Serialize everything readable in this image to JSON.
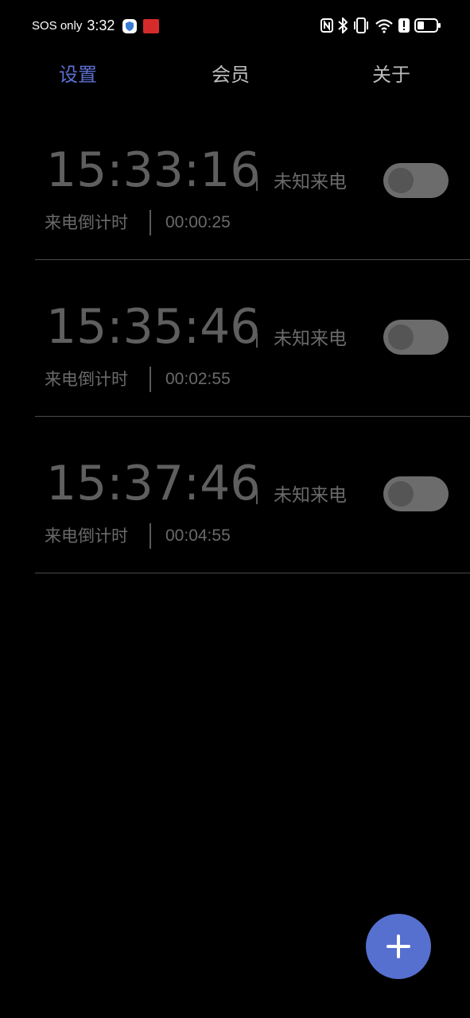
{
  "status_bar": {
    "carrier": "SOS only",
    "time": "3:32",
    "icons": [
      "shield-icon",
      "app-icon",
      "nfc-icon",
      "bluetooth-icon",
      "vibrate-icon",
      "wifi-icon",
      "alert-icon",
      "battery-icon"
    ]
  },
  "tabs": [
    {
      "label": "设置",
      "active": true
    },
    {
      "label": "会员",
      "active": false
    },
    {
      "label": "关于",
      "active": false
    }
  ],
  "alarms": [
    {
      "time": "15:33:16",
      "type": "未知来电",
      "countdown_label": "来电倒计时",
      "countdown": "00:00:25",
      "enabled": false
    },
    {
      "time": "15:35:46",
      "type": "未知来电",
      "countdown_label": "来电倒计时",
      "countdown": "00:02:55",
      "enabled": false
    },
    {
      "time": "15:37:46",
      "type": "未知来电",
      "countdown_label": "来电倒计时",
      "countdown": "00:04:55",
      "enabled": false
    }
  ],
  "fab": {
    "icon": "plus-icon"
  },
  "colors": {
    "background": "#000000",
    "accent": "#5670d0",
    "active_tab": "#5b6fd0",
    "inactive_tab": "#bdbdbd",
    "muted_text": "#6a6a6a"
  }
}
